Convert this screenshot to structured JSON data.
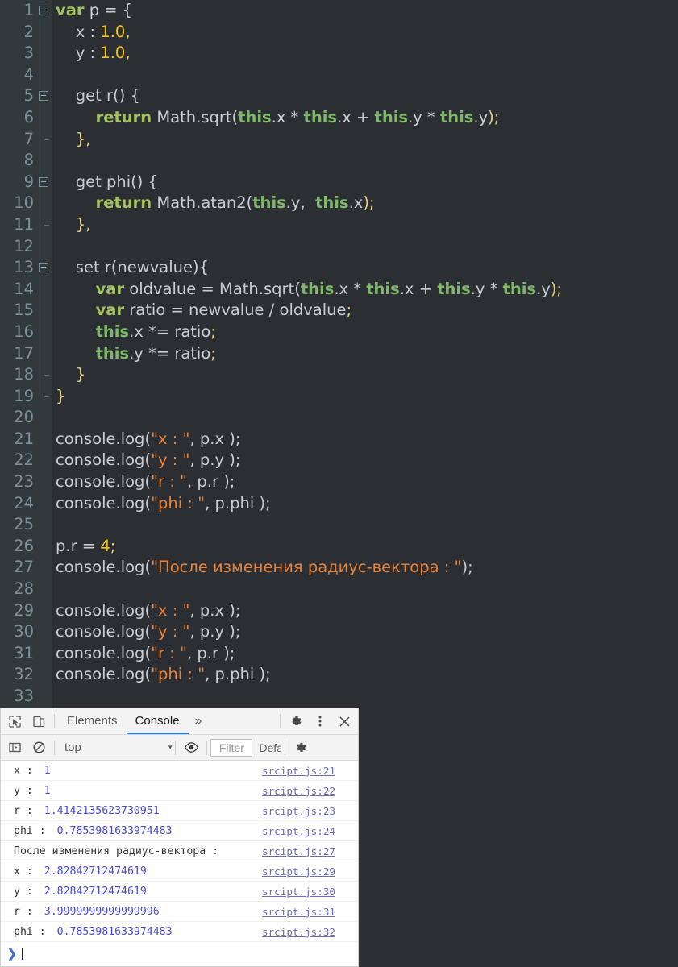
{
  "editor": {
    "name": "code-editor",
    "background": "#2b2f33",
    "gutter_background": "#32393d",
    "lines": [
      {
        "n": "1",
        "fold": "start-top",
        "tokens": [
          {
            "t": "var",
            "c": "kw"
          },
          {
            "t": " p = {",
            "c": "plain"
          }
        ]
      },
      {
        "n": "2",
        "fold": "bar",
        "tokens": [
          {
            "t": "    x : ",
            "c": "plain"
          },
          {
            "t": "1.0",
            "c": "num"
          },
          {
            "t": ",",
            "c": "punc"
          }
        ]
      },
      {
        "n": "3",
        "fold": "bar",
        "tokens": [
          {
            "t": "    y : ",
            "c": "plain"
          },
          {
            "t": "1.0",
            "c": "num"
          },
          {
            "t": ",",
            "c": "punc"
          }
        ]
      },
      {
        "n": "4",
        "fold": "bar",
        "tokens": []
      },
      {
        "n": "5",
        "fold": "start-inner",
        "tokens": [
          {
            "t": "    get r() {",
            "c": "plain"
          }
        ]
      },
      {
        "n": "6",
        "fold": "bar",
        "tokens": [
          {
            "t": "        ",
            "c": "plain"
          },
          {
            "t": "return",
            "c": "kw"
          },
          {
            "t": " Math.sqrt(",
            "c": "plain"
          },
          {
            "t": "this",
            "c": "this"
          },
          {
            "t": ".x * ",
            "c": "plain"
          },
          {
            "t": "this",
            "c": "this"
          },
          {
            "t": ".x + ",
            "c": "plain"
          },
          {
            "t": "this",
            "c": "this"
          },
          {
            "t": ".y * ",
            "c": "plain"
          },
          {
            "t": "this",
            "c": "this"
          },
          {
            "t": ".y",
            "c": "plain"
          },
          {
            "t": ");",
            "c": "punc"
          }
        ]
      },
      {
        "n": "7",
        "fold": "end-inner",
        "tokens": [
          {
            "t": "    }",
            "c": "punc"
          },
          {
            "t": ",",
            "c": "punc"
          }
        ]
      },
      {
        "n": "8",
        "fold": "bar",
        "tokens": []
      },
      {
        "n": "9",
        "fold": "start-inner",
        "tokens": [
          {
            "t": "    get phi() {",
            "c": "plain"
          }
        ]
      },
      {
        "n": "10",
        "fold": "bar",
        "tokens": [
          {
            "t": "        ",
            "c": "plain"
          },
          {
            "t": "return",
            "c": "kw"
          },
          {
            "t": " Math.atan2(",
            "c": "plain"
          },
          {
            "t": "this",
            "c": "this"
          },
          {
            "t": ".y,  ",
            "c": "plain"
          },
          {
            "t": "this",
            "c": "this"
          },
          {
            "t": ".x",
            "c": "plain"
          },
          {
            "t": ");",
            "c": "punc"
          }
        ]
      },
      {
        "n": "11",
        "fold": "end-inner",
        "tokens": [
          {
            "t": "    }",
            "c": "punc"
          },
          {
            "t": ",",
            "c": "punc"
          }
        ]
      },
      {
        "n": "12",
        "fold": "bar",
        "tokens": []
      },
      {
        "n": "13",
        "fold": "start-inner",
        "tokens": [
          {
            "t": "    set r(newvalue){",
            "c": "plain"
          }
        ]
      },
      {
        "n": "14",
        "fold": "bar",
        "tokens": [
          {
            "t": "        ",
            "c": "plain"
          },
          {
            "t": "var",
            "c": "kw"
          },
          {
            "t": " oldvalue = Math.sqrt(",
            "c": "plain"
          },
          {
            "t": "this",
            "c": "this"
          },
          {
            "t": ".x * ",
            "c": "plain"
          },
          {
            "t": "this",
            "c": "this"
          },
          {
            "t": ".x + ",
            "c": "plain"
          },
          {
            "t": "this",
            "c": "this"
          },
          {
            "t": ".y * ",
            "c": "plain"
          },
          {
            "t": "this",
            "c": "this"
          },
          {
            "t": ".y",
            "c": "plain"
          },
          {
            "t": ");",
            "c": "punc"
          }
        ]
      },
      {
        "n": "15",
        "fold": "bar",
        "tokens": [
          {
            "t": "        ",
            "c": "plain"
          },
          {
            "t": "var",
            "c": "kw"
          },
          {
            "t": " ratio = newvalue / oldvalue",
            "c": "plain"
          },
          {
            "t": ";",
            "c": "punc"
          }
        ]
      },
      {
        "n": "16",
        "fold": "bar",
        "tokens": [
          {
            "t": "        ",
            "c": "plain"
          },
          {
            "t": "this",
            "c": "this"
          },
          {
            "t": ".x *= ratio",
            "c": "plain"
          },
          {
            "t": ";",
            "c": "punc"
          }
        ]
      },
      {
        "n": "17",
        "fold": "bar",
        "tokens": [
          {
            "t": "        ",
            "c": "plain"
          },
          {
            "t": "this",
            "c": "this"
          },
          {
            "t": ".y *= ratio",
            "c": "plain"
          },
          {
            "t": ";",
            "c": "punc"
          }
        ]
      },
      {
        "n": "18",
        "fold": "end-inner",
        "tokens": [
          {
            "t": "    }",
            "c": "punc"
          }
        ]
      },
      {
        "n": "19",
        "fold": "end-top",
        "tokens": [
          {
            "t": "}",
            "c": "punc"
          }
        ]
      },
      {
        "n": "20",
        "fold": "none",
        "tokens": []
      },
      {
        "n": "21",
        "fold": "none",
        "tokens": [
          {
            "t": "console.log(",
            "c": "plain"
          },
          {
            "t": "\"x : \"",
            "c": "str"
          },
          {
            "t": ", p.x );",
            "c": "plain"
          }
        ]
      },
      {
        "n": "22",
        "fold": "none",
        "tokens": [
          {
            "t": "console.log(",
            "c": "plain"
          },
          {
            "t": "\"y : \"",
            "c": "str"
          },
          {
            "t": ", p.y );",
            "c": "plain"
          }
        ]
      },
      {
        "n": "23",
        "fold": "none",
        "tokens": [
          {
            "t": "console.log(",
            "c": "plain"
          },
          {
            "t": "\"r : \"",
            "c": "str"
          },
          {
            "t": ", p.r );",
            "c": "plain"
          }
        ]
      },
      {
        "n": "24",
        "fold": "none",
        "tokens": [
          {
            "t": "console.log(",
            "c": "plain"
          },
          {
            "t": "\"phi : \"",
            "c": "str"
          },
          {
            "t": ", p.phi );",
            "c": "plain"
          }
        ]
      },
      {
        "n": "25",
        "fold": "none",
        "tokens": []
      },
      {
        "n": "26",
        "fold": "none",
        "tokens": [
          {
            "t": "p.r = ",
            "c": "plain"
          },
          {
            "t": "4",
            "c": "num"
          },
          {
            "t": ";",
            "c": "punc"
          }
        ]
      },
      {
        "n": "27",
        "fold": "none",
        "tokens": [
          {
            "t": "console.log(",
            "c": "plain"
          },
          {
            "t": "\"После изменения радиус-вектора : \"",
            "c": "str"
          },
          {
            "t": ");",
            "c": "plain"
          }
        ]
      },
      {
        "n": "28",
        "fold": "none",
        "tokens": []
      },
      {
        "n": "29",
        "fold": "none",
        "tokens": [
          {
            "t": "console.log(",
            "c": "plain"
          },
          {
            "t": "\"x : \"",
            "c": "str"
          },
          {
            "t": ", p.x );",
            "c": "plain"
          }
        ]
      },
      {
        "n": "30",
        "fold": "none",
        "tokens": [
          {
            "t": "console.log(",
            "c": "plain"
          },
          {
            "t": "\"y : \"",
            "c": "str"
          },
          {
            "t": ", p.y );",
            "c": "plain"
          }
        ]
      },
      {
        "n": "31",
        "fold": "none",
        "tokens": [
          {
            "t": "console.log(",
            "c": "plain"
          },
          {
            "t": "\"r : \"",
            "c": "str"
          },
          {
            "t": ", p.r );",
            "c": "plain"
          }
        ]
      },
      {
        "n": "32",
        "fold": "none",
        "tokens": [
          {
            "t": "console.log(",
            "c": "plain"
          },
          {
            "t": "\"phi : \"",
            "c": "str"
          },
          {
            "t": ", p.phi );",
            "c": "plain"
          }
        ]
      },
      {
        "n": "33",
        "fold": "none",
        "tokens": []
      }
    ]
  },
  "devtools": {
    "tabs": [
      {
        "label": "Elements",
        "active": false
      },
      {
        "label": "Console",
        "active": true
      }
    ],
    "more_tabs_label": "»",
    "toolbar2": {
      "context": "top",
      "context_arrow": "▾",
      "filter_placeholder": "Filter",
      "levels_label": "Default levels"
    },
    "console": {
      "rows": [
        {
          "label": "x : ",
          "value": "1",
          "source": "srcipt.js:21"
        },
        {
          "label": "y : ",
          "value": "1",
          "source": "srcipt.js:22"
        },
        {
          "label": "r : ",
          "value": "1.4142135623730951",
          "source": "srcipt.js:23"
        },
        {
          "label": "phi : ",
          "value": "0.7853981633974483",
          "source": "srcipt.js:24"
        },
        {
          "label": "После изменения радиус-вектора : ",
          "value": "",
          "source": "srcipt.js:27"
        },
        {
          "label": "x : ",
          "value": "2.82842712474619",
          "source": "srcipt.js:29"
        },
        {
          "label": "y : ",
          "value": "2.82842712474619",
          "source": "srcipt.js:30"
        },
        {
          "label": "r : ",
          "value": "3.9999999999999996",
          "source": "srcipt.js:31"
        },
        {
          "label": "phi : ",
          "value": "0.7853981633974483",
          "source": "srcipt.js:32"
        }
      ],
      "prompt_arrow": "❯",
      "prompt_value": ""
    }
  },
  "colors": {
    "editor_bg": "#2b2f33",
    "gutter_bg": "#32393d",
    "keyword": "#a5c261",
    "this_kw": "#7fb86b",
    "number": "#f5c518",
    "string": "#e8833a",
    "punct": "#e6d27a",
    "plain": "#c8cdd2",
    "console_value": "#4a4ae0",
    "console_link": "#6b6bbf",
    "tab_accent": "#1a73e8"
  }
}
